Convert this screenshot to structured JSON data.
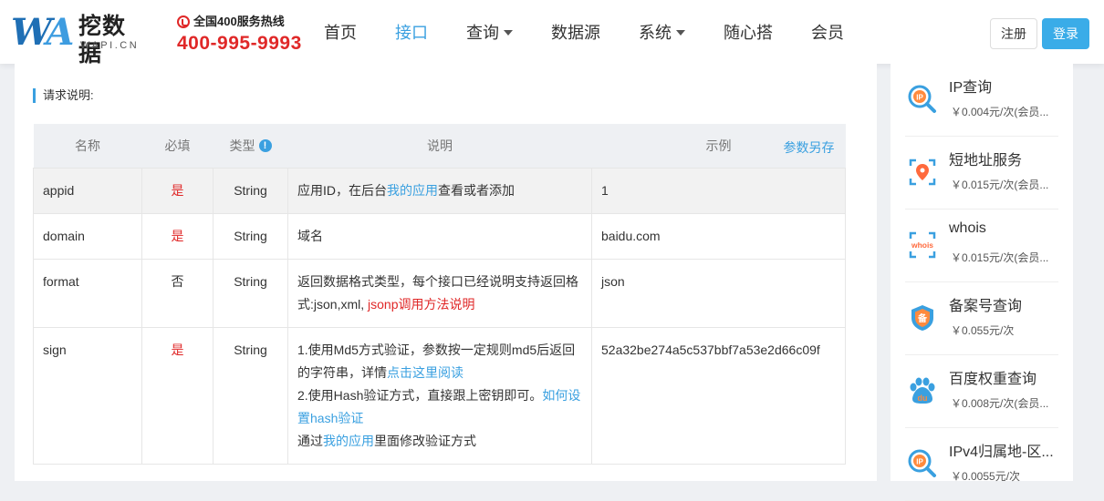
{
  "brand": {
    "mark_w": "W",
    "mark_a": "A",
    "name_cn": "挖数据",
    "name_en": "WAPI.CN"
  },
  "hotline": {
    "label": "全国400服务热线",
    "number": "400-995-9993"
  },
  "nav": [
    {
      "label": "首页",
      "active": false,
      "dropdown": false
    },
    {
      "label": "接口",
      "active": true,
      "dropdown": false
    },
    {
      "label": "查询",
      "active": false,
      "dropdown": true
    },
    {
      "label": "数据源",
      "active": false,
      "dropdown": false
    },
    {
      "label": "系统",
      "active": false,
      "dropdown": true
    },
    {
      "label": "随心搭",
      "active": false,
      "dropdown": false
    },
    {
      "label": "会员",
      "active": false,
      "dropdown": false
    }
  ],
  "auth": {
    "register": "注册",
    "login": "登录"
  },
  "section_title": "请求说明:",
  "table": {
    "headers": {
      "name": "名称",
      "required": "必填",
      "type": "类型",
      "desc": "说明",
      "example": "示例",
      "save": "参数另存"
    },
    "rows": [
      {
        "name": "appid",
        "required": "是",
        "type": "String",
        "desc_pre": "应用ID，在后台",
        "desc_link": "我的应用",
        "desc_post": "查看或者添加",
        "example": "1"
      },
      {
        "name": "domain",
        "required": "是",
        "type": "String",
        "desc": "域名",
        "example": "baidu.com"
      },
      {
        "name": "format",
        "required": "否",
        "type": "String",
        "desc_pre": "返回数据格式类型，每个接口已经说明支持返回格式:json,xml,",
        "desc_link": "jsonp调用方法说明",
        "example": "json"
      },
      {
        "name": "sign",
        "required": "是",
        "type": "String",
        "line1_pre": "1.使用Md5方式验证，参数按一定规则md5后返回的字符串，详情",
        "line1_link": "点击这里阅读",
        "line2_pre": "2.使用Hash验证方式，直接跟上密钥即可。",
        "line2_link": "如何设置hash验证",
        "line3_pre": "通过",
        "line3_link": "我的应用",
        "line3_post": "里面修改验证方式",
        "example": "52a32be274a5c537bbf7a53e2d66c09f"
      }
    ]
  },
  "sidebar": [
    {
      "icon": "ip-search-icon",
      "title": "IP查询",
      "price": "￥0.004元/次(会员..."
    },
    {
      "icon": "short-url-icon",
      "title": "短地址服务",
      "price": "￥0.015元/次(会员..."
    },
    {
      "icon": "whois-icon",
      "title": "whois",
      "price": "￥0.015元/次(会员...",
      "icon_text": "whois"
    },
    {
      "icon": "icp-icon",
      "title": "备案号查询",
      "price": "￥0.055元/次",
      "icon_text": "备"
    },
    {
      "icon": "baidu-weight-icon",
      "title": "百度权重查询",
      "price": "￥0.008元/次(会员...",
      "icon_text": "du"
    },
    {
      "icon": "ipv4-icon",
      "title": "IPv4归属地-区...",
      "price": "￥0.0055元/次"
    }
  ],
  "colors": {
    "accent": "#3aa0e0",
    "red": "#e02828",
    "login_bg": "#3aace8"
  }
}
